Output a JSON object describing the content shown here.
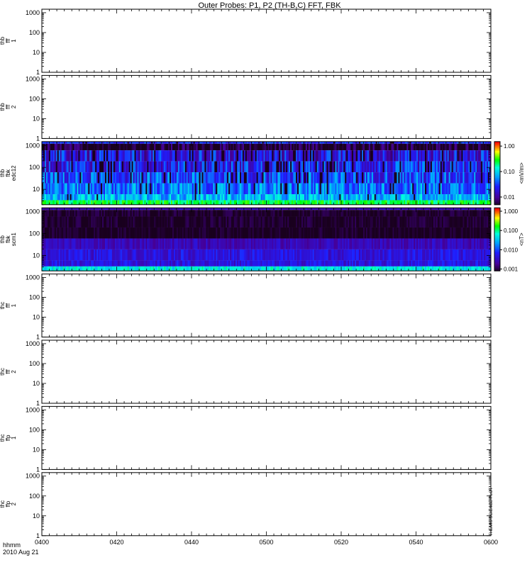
{
  "page": {
    "title": "Outer Probes: P1, P2 (TH-B,C) FFT, FBK",
    "footer_fmt": "hhmm",
    "footer_date": "2010 Aug 21",
    "side_stamp": "THEMIS SCIENCE PLOT"
  },
  "chart_data": {
    "type": "heatmap",
    "title": "Outer Probes: P1, P2 (TH-B,C) FFT, FBK",
    "x": {
      "tick_labels": [
        "0400",
        "0420",
        "0440",
        "0500",
        "0520",
        "0540",
        "0600"
      ],
      "range": [
        "0400",
        "0600"
      ],
      "label": "hhmm"
    },
    "y_scale": "log",
    "y_tick_labels": [
      "1",
      "10",
      "100",
      "1000"
    ],
    "panels": [
      {
        "label_lines": [
          "thb",
          "fff",
          "1"
        ],
        "ylim": [
          1,
          1500
        ],
        "has_data": false
      },
      {
        "label_lines": [
          "thb",
          "fff",
          "2"
        ],
        "ylim": [
          1,
          1500
        ],
        "has_data": false
      },
      {
        "label_lines": [
          "thb",
          "fbk",
          "edc12"
        ],
        "ylim": [
          2,
          1500
        ],
        "has_data": true,
        "colorbar": {
          "label": "<mV/m>",
          "scale": "log",
          "range": [
            0.005,
            1.5
          ],
          "tick_labels": [
            "1.00",
            "0.10",
            "0.01"
          ]
        },
        "bands": [
          {
            "fmin": 1200,
            "fmax": 1500,
            "level": 0.03,
            "var": 0.4,
            "dropout": 0.04
          },
          {
            "fmin": 600,
            "fmax": 1200,
            "level": 0.006,
            "var": 0.5,
            "dropout": 0.2
          },
          {
            "fmin": 190,
            "fmax": 600,
            "level": 0.02,
            "var": 0.8,
            "dropout": 0.12
          },
          {
            "fmin": 60,
            "fmax": 190,
            "level": 0.025,
            "var": 0.8,
            "dropout": 0.15
          },
          {
            "fmin": 19,
            "fmax": 60,
            "level": 0.035,
            "var": 0.8,
            "dropout": 0.12
          },
          {
            "fmin": 6,
            "fmax": 19,
            "level": 0.05,
            "var": 0.7,
            "dropout": 0.08
          },
          {
            "fmin": 3.2,
            "fmax": 6,
            "level": 0.08,
            "var": 0.6,
            "dropout": 0.03
          },
          {
            "fmin": 2,
            "fmax": 3.2,
            "level": 0.25,
            "var": 0.4,
            "dropout": 0.0
          }
        ]
      },
      {
        "label_lines": [
          "thb",
          "fbk",
          "scm1"
        ],
        "ylim": [
          2,
          1500
        ],
        "has_data": true,
        "colorbar": {
          "label": "<nT>",
          "scale": "log",
          "range": [
            0.0008,
            1.5
          ],
          "tick_labels": [
            "1.000",
            "0.100",
            "0.010",
            "0.001"
          ]
        },
        "bands": [
          {
            "fmin": 1200,
            "fmax": 1500,
            "level": 0.003,
            "var": 0.3,
            "dropout": 0.0
          },
          {
            "fmin": 600,
            "fmax": 1200,
            "level": 0.0009,
            "var": 0.3,
            "dropout": 0.0
          },
          {
            "fmin": 190,
            "fmax": 600,
            "level": 0.0009,
            "var": 0.3,
            "dropout": 0.0
          },
          {
            "fmin": 60,
            "fmax": 190,
            "level": 0.0008,
            "var": 0.3,
            "dropout": 0.0
          },
          {
            "fmin": 19,
            "fmax": 60,
            "level": 0.003,
            "var": 0.4,
            "dropout": 0.0
          },
          {
            "fmin": 6,
            "fmax": 19,
            "level": 0.005,
            "var": 0.5,
            "dropout": 0.0
          },
          {
            "fmin": 3.2,
            "fmax": 6,
            "level": 0.005,
            "var": 0.5,
            "dropout": 0.0
          },
          {
            "fmin": 2,
            "fmax": 3.2,
            "level": 0.06,
            "var": 0.5,
            "dropout": 0.0
          }
        ]
      },
      {
        "label_lines": [
          "thc",
          "fff",
          "1"
        ],
        "ylim": [
          1,
          1500
        ],
        "has_data": false
      },
      {
        "label_lines": [
          "thc",
          "fff",
          "2"
        ],
        "ylim": [
          1,
          1500
        ],
        "has_data": false
      },
      {
        "label_lines": [
          "thc",
          "ffp",
          "1"
        ],
        "ylim": [
          1,
          1500
        ],
        "has_data": false
      },
      {
        "label_lines": [
          "thc",
          "ffp",
          "2"
        ],
        "ylim": [
          1,
          1500
        ],
        "has_data": false
      }
    ]
  }
}
